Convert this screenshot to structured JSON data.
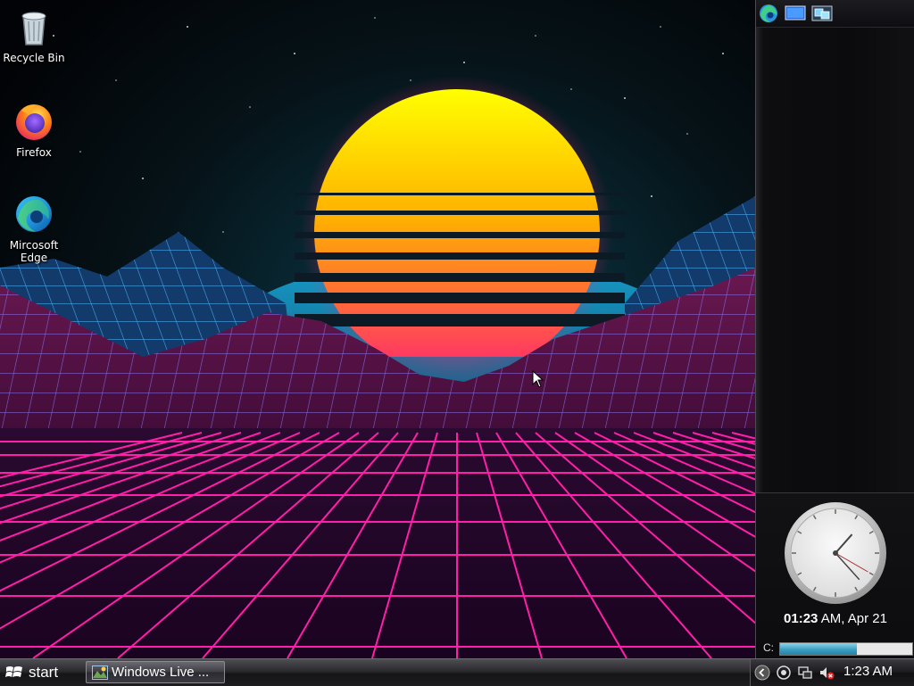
{
  "desktop": {
    "icons": [
      {
        "label": "Recycle Bin",
        "icon": "recycle-bin-icon"
      },
      {
        "label": "Firefox",
        "icon": "firefox-icon"
      },
      {
        "label": "Mircosoft\nEdge",
        "icon": "edge-icon"
      }
    ]
  },
  "sidebar": {
    "toolbar": [
      {
        "icon": "edge-icon"
      },
      {
        "icon": "show-desktop-icon"
      },
      {
        "icon": "switch-windows-icon"
      }
    ],
    "clock": {
      "time": "01:23",
      "suffix": " AM, Apr 21"
    },
    "drive": {
      "label": "C:",
      "used_fraction": 0.58
    }
  },
  "taskbar": {
    "start_label": "start",
    "task_item_label": "Windows Live ...",
    "tray_time": "1:23 AM"
  },
  "colors": {
    "sun_top": "#ffff00",
    "sun_bottom": "#ff2a6d",
    "grid": "#ff1fa8",
    "mountain_grid": "#6f8cff"
  }
}
